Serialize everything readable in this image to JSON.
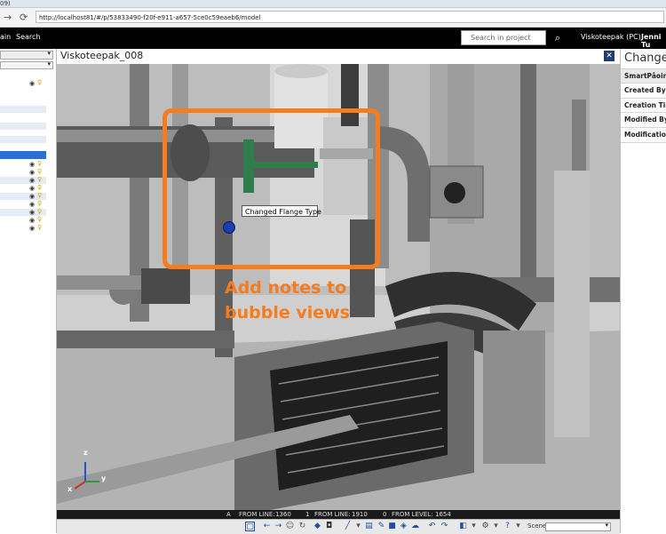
{
  "browser": {
    "title_fragment": "09)",
    "url": "http://localhost81/#/p/53833490-f20f-e911-a657-5ce0c59eaeb6/model",
    "back_icon": "arrow-left",
    "forward_icon": "arrow-right",
    "refresh_icon": "refresh"
  },
  "appbar": {
    "menu_fragment": "ain",
    "search_link": "Search",
    "search_placeholder": "Search in project",
    "project": "Viskoteepak (PC)",
    "user_fragment": "Jenni Tu"
  },
  "viewer": {
    "title": "Viskoteepak_008",
    "tooltip": "Changed Flange Type",
    "overlay_note": "Add notes to bubble views",
    "status": {
      "a": "A",
      "from_line_label": "FROM LINE:",
      "from_line_value": "1360",
      "b": "1",
      "from_line2_value": "1910",
      "c": "0",
      "from_level_label": "FROM LEVEL:",
      "from_level_value": "1654"
    },
    "scene_label": "Scene:",
    "axis": {
      "x": "x",
      "y": "y",
      "z": "z"
    }
  },
  "rightpanel": {
    "title": "Changed",
    "fields": [
      "SmartPåoint",
      "Created By",
      "Creation Time",
      "Modified By",
      "Modification T"
    ]
  },
  "colors": {
    "accent": "#f57c1f",
    "header_bg": "#000000",
    "selection": "#2b6fd6",
    "marker": "#1b3fb0"
  }
}
